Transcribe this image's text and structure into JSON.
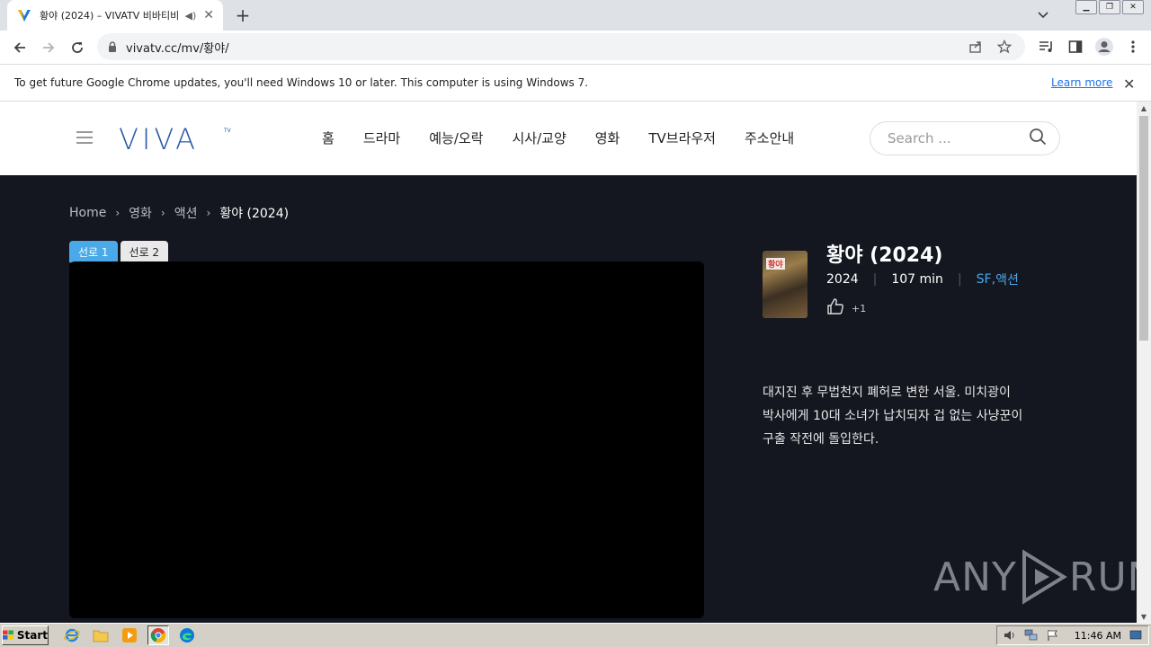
{
  "browser": {
    "tab_title": "황야 (2024) – VIVATV 비바티비",
    "url": "vivatv.cc/mv/황야/",
    "infobar_text": "To get future Google Chrome updates, you'll need Windows 10 or later. This computer is using Windows 7.",
    "learn_more": "Learn more"
  },
  "site": {
    "logo_text": "VIVA",
    "logo_tm": "TV",
    "nav": [
      "홈",
      "드라마",
      "예능/오락",
      "시사/교양",
      "영화",
      "TV브라우저",
      "주소안내"
    ],
    "search_placeholder": "Search ..."
  },
  "breadcrumb": [
    "Home",
    "영화",
    "액션",
    "황야 (2024)"
  ],
  "server_tabs": [
    "선로 1",
    "선로 2"
  ],
  "movie": {
    "title": "황야 (2024)",
    "year": "2024",
    "runtime": "107 min",
    "genre_1": "SF",
    "genre_sep": ", ",
    "genre_2": "액션",
    "likes": "+1",
    "poster_label": "황야",
    "synopsis": "대지진 후 무법천지 폐허로 변한 서울. 미치광이 박사에게 10대 소녀가 납치되자 겁 없는 사냥꾼이 구출 작전에 돌입한다."
  },
  "watermark": {
    "left": "ANY",
    "right": "RUN"
  },
  "taskbar": {
    "start": "Start",
    "clock": "11:46 AM"
  },
  "colors": {
    "accent": "#4aa9e8",
    "page_bg": "#141720",
    "logo": "#2b5aa8"
  }
}
